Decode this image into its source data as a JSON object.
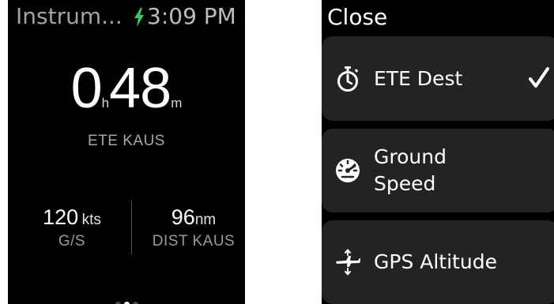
{
  "left_screen": {
    "app_title": "Instrum...",
    "time": "3:09 PM",
    "ete": {
      "hours": "0",
      "hours_unit": "h",
      "minutes": "48",
      "minutes_unit": "m",
      "label": "ETE KAUS"
    },
    "ground_speed": {
      "value": "120",
      "unit": "kts",
      "label": "G/S"
    },
    "distance": {
      "value": "96",
      "unit": "nm",
      "label": "DIST KAUS"
    },
    "pager": {
      "pages": 3,
      "active_index": 1
    },
    "colors": {
      "charging_bolt": "#31d158"
    }
  },
  "right_screen": {
    "close_label": "Close",
    "menu_items": [
      {
        "icon": "stopwatch-icon",
        "label": "ETE Dest",
        "selected": true
      },
      {
        "icon": "speedometer-icon",
        "label_line1": "Ground",
        "label_line2": "Speed",
        "selected": false
      },
      {
        "icon": "airplane-altitude-icon",
        "label": "GPS Altitude",
        "selected": false
      }
    ]
  }
}
